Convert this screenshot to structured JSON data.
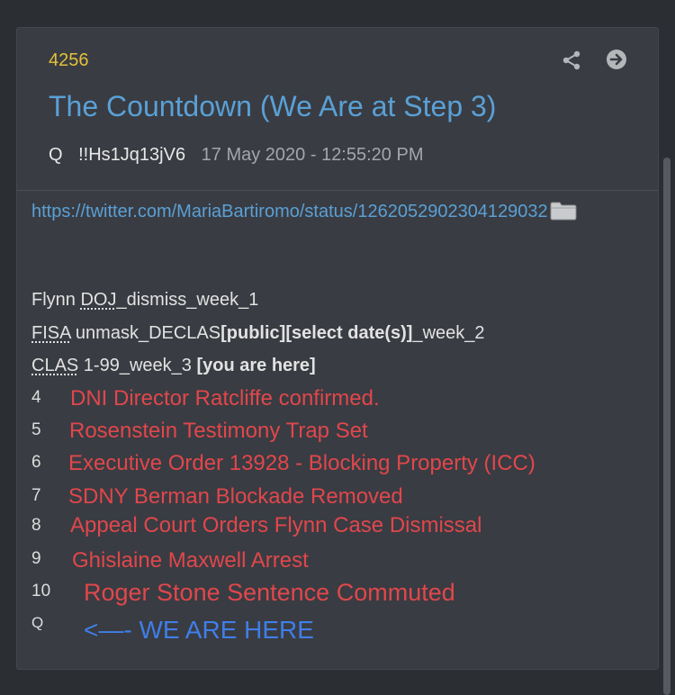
{
  "post": {
    "number": "4256",
    "title": "The Countdown (We Are at Step 3)",
    "author": "Q",
    "tripcode": "!!Hs1Jq13jV6",
    "timestamp": "17 May 2020 - 12:55:20 PM"
  },
  "icons": {
    "share": "share-icon",
    "open": "arrow-right-circle-icon",
    "folder": "folder-icon"
  },
  "body": {
    "link_line1": "https://twitter.com/MariaBartiromo/status/12620529023041",
    "link_line2": "29032",
    "line1": {
      "pre": "Flynn ",
      "abbr": "DOJ",
      "post": "_dismiss_week_1"
    },
    "line2": {
      "abbr": "FISA",
      "mid": " unmask_DECLAS",
      "bold": "[public][select date(s)]",
      "post": "_week_2"
    },
    "line3": {
      "abbr": "CLAS",
      "mid": " 1-99_week_3 ",
      "bold": "[you are here]"
    }
  },
  "steps": [
    {
      "num": "4",
      "text": "DNI Director Ratcliffe confirmed."
    },
    {
      "num": "5",
      "text": "Rosenstein Testimony Trap Set"
    },
    {
      "num": "6",
      "text": "Executive Order 13928 - Blocking Property (ICC)"
    },
    {
      "num": "7",
      "text": "SDNY Berman Blockade Removed"
    },
    {
      "num": "8",
      "text": "Appeal Court Orders Flynn Case Dismissal"
    },
    {
      "num": "9",
      "text": "Ghislaine Maxwell Arrest"
    },
    {
      "num": "10",
      "text": "Roger Stone Sentence Commuted"
    },
    {
      "num": "Q",
      "text": "<—- WE ARE HERE"
    }
  ],
  "colors": {
    "background": "#2b2e33",
    "card": "#393c42",
    "number": "#e2c23a",
    "title": "#5aa0d6",
    "annotation_red": "#e0474c",
    "annotation_blue": "#3f7ee8"
  }
}
